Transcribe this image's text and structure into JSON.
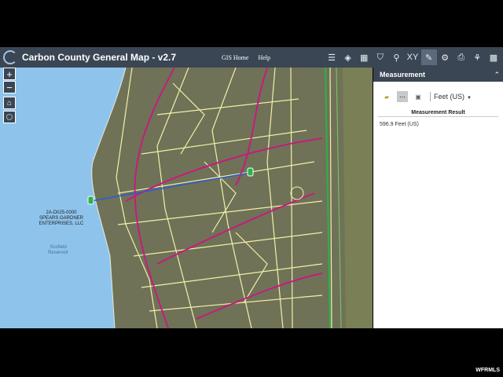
{
  "app": {
    "title": "Carbon County General Map - v2.7"
  },
  "toplinks": [
    "GIS Home",
    "Help"
  ],
  "tools": [
    {
      "name": "legend-icon",
      "glyph": "☰"
    },
    {
      "name": "layers-icon",
      "glyph": "◈"
    },
    {
      "name": "basemap-gallery-icon",
      "glyph": "▦"
    },
    {
      "name": "bookmark-icon",
      "glyph": "⛉"
    },
    {
      "name": "search-icon",
      "glyph": "⚲"
    },
    {
      "name": "coordinate-icon",
      "glyph": "XY"
    },
    {
      "name": "measure-icon",
      "glyph": "✎"
    },
    {
      "name": "print-options-icon",
      "glyph": "⚙"
    },
    {
      "name": "print-icon",
      "glyph": "⎙"
    },
    {
      "name": "share-icon",
      "glyph": "⚘"
    },
    {
      "name": "grid-icon",
      "glyph": "▩"
    }
  ],
  "map": {
    "parcel_label": "2A-D025-0000\nSPEARS GARDNER\nENTERPRISES, LLC",
    "water_label": "Scofield\nReservoir"
  },
  "panel": {
    "title": "Measurement",
    "units": "Feet (US)",
    "result_heading": "Measurement Result",
    "result_value": "596.9 Feet (US)"
  },
  "watermark": "WFRMLS",
  "colors": {
    "toolbar": "#3b4654",
    "water": "#8ec4ec",
    "parcel": "#f2f0a8",
    "road": "#c41c7e",
    "measure": "#2a5ad8"
  }
}
